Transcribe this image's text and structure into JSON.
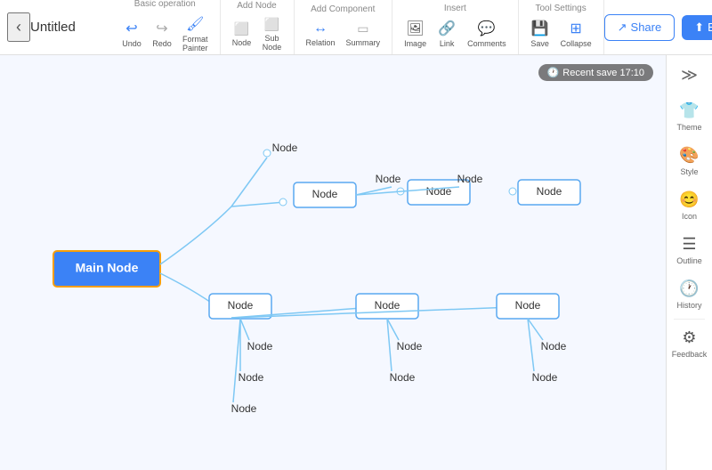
{
  "toolbar": {
    "back_icon": "‹",
    "title": "Untitled",
    "sections": [
      {
        "label": "Basic operation",
        "buttons": [
          {
            "id": "undo",
            "icon": "↩",
            "label": "Undo"
          },
          {
            "id": "redo",
            "icon": "↪",
            "label": "Redo"
          },
          {
            "id": "format-painter",
            "icon": "🖌",
            "label": "Format Painter"
          }
        ]
      },
      {
        "label": "Add Node",
        "buttons": [
          {
            "id": "node",
            "icon": "⬜",
            "label": "Node"
          },
          {
            "id": "sub-node",
            "icon": "⬜",
            "label": "Sub Node"
          }
        ]
      },
      {
        "label": "Add Component",
        "buttons": [
          {
            "id": "relation",
            "icon": "↔",
            "label": "Relation"
          },
          {
            "id": "summary",
            "icon": "▭",
            "label": "Summary"
          }
        ]
      },
      {
        "label": "Insert",
        "buttons": [
          {
            "id": "image",
            "icon": "🖼",
            "label": "Image"
          },
          {
            "id": "link",
            "icon": "🔗",
            "label": "Link"
          },
          {
            "id": "comments",
            "icon": "💬",
            "label": "Comments"
          }
        ]
      },
      {
        "label": "Tool Settings",
        "buttons": [
          {
            "id": "save",
            "icon": "💾",
            "label": "Save"
          },
          {
            "id": "collapse",
            "icon": "⊞",
            "label": "Collapse"
          }
        ]
      }
    ],
    "share_label": "Share",
    "export_label": "Export"
  },
  "canvas": {
    "recent_save": "Recent save 17:10"
  },
  "right_panel": {
    "collapse_icon": "≫",
    "items": [
      {
        "id": "theme",
        "icon": "👕",
        "label": "Theme"
      },
      {
        "id": "style",
        "icon": "🎨",
        "label": "Style"
      },
      {
        "id": "icon",
        "icon": "😊",
        "label": "Icon"
      },
      {
        "id": "outline",
        "icon": "☰",
        "label": "Outline"
      },
      {
        "id": "history",
        "icon": "🕐",
        "label": "History"
      },
      {
        "id": "feedback",
        "icon": "⚙",
        "label": "Feedback"
      }
    ]
  },
  "mindmap": {
    "main_node": "Main Node",
    "nodes": [
      "Node",
      "Node",
      "Node",
      "Node",
      "Node",
      "Node",
      "Node",
      "Node",
      "Node",
      "Node",
      "Node",
      "Node",
      "Node",
      "Node",
      "Node"
    ]
  }
}
